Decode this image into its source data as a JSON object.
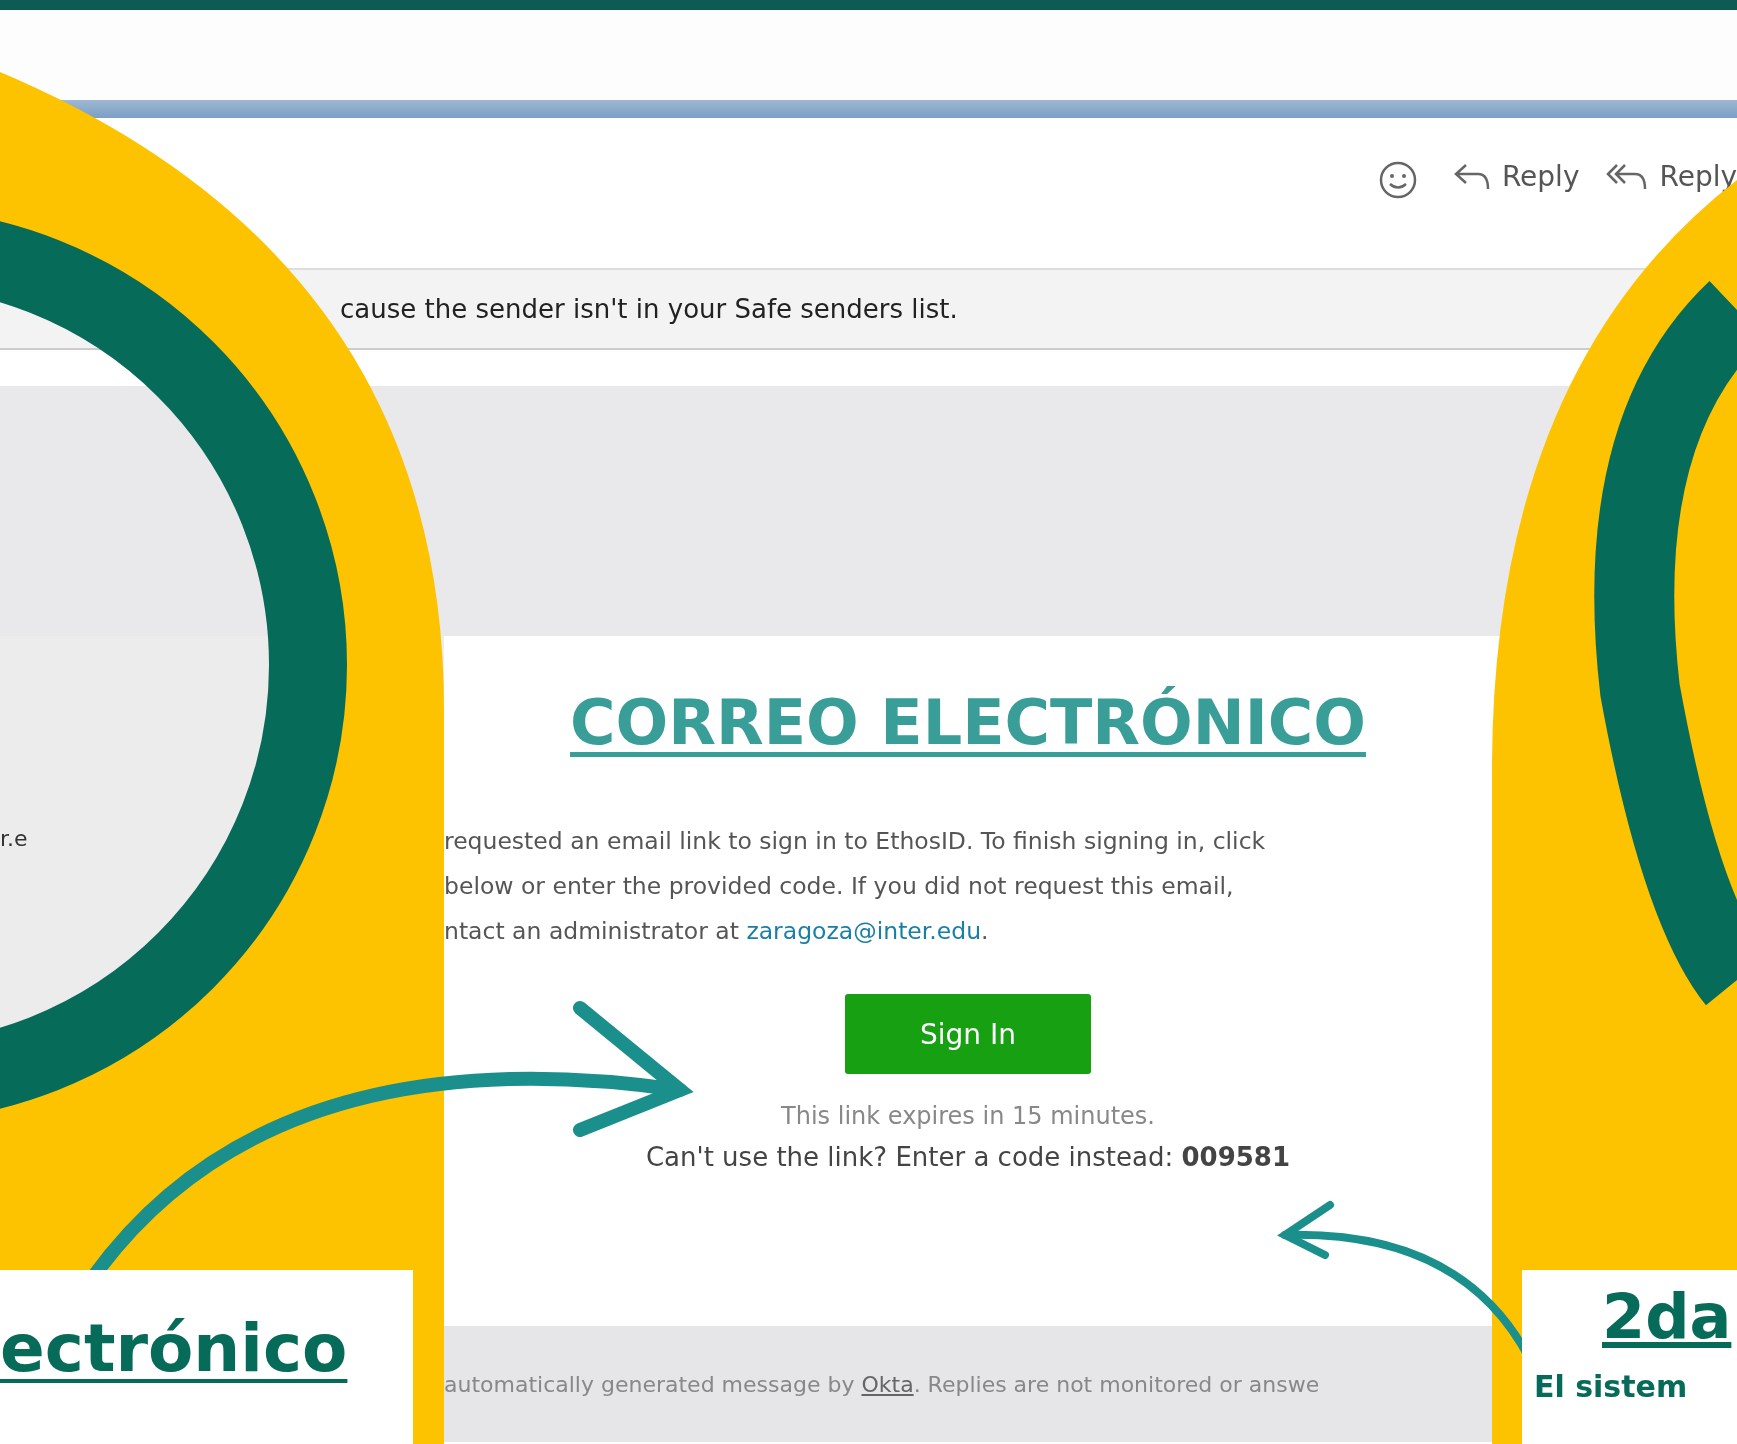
{
  "toolbar": {
    "actions": [
      {
        "kind": "emoji"
      },
      {
        "kind": "reply",
        "label": "Reply"
      },
      {
        "kind": "reply_all",
        "label": "Reply"
      }
    ]
  },
  "warning": "cause the sender isn't in your Safe senders list.",
  "list_fragment": "r.e",
  "banner_title": "CORREO ELECTRÓNICO",
  "message": {
    "lines": [
      "requested an email link to sign in to EthosID. To finish signing in, click",
      " below or enter the provided code. If you did not request this email,",
      "ntact an administrator at "
    ],
    "email": "zaragoza@inter.edu",
    "email_after": ".",
    "button": "Sign In",
    "expires": "This link expires in 15 minutes.",
    "code_prompt": "Can't use the link? Enter a code instead: **009581**"
  },
  "footer": {
    "before": "automatically generated message by ",
    "link": "Okta",
    "after": ". Replies are not monitored or answe"
  },
  "left_card": {
    "heading": "ectrónico"
  },
  "right_card": {
    "heading": "2da",
    "text": "El sistem"
  }
}
